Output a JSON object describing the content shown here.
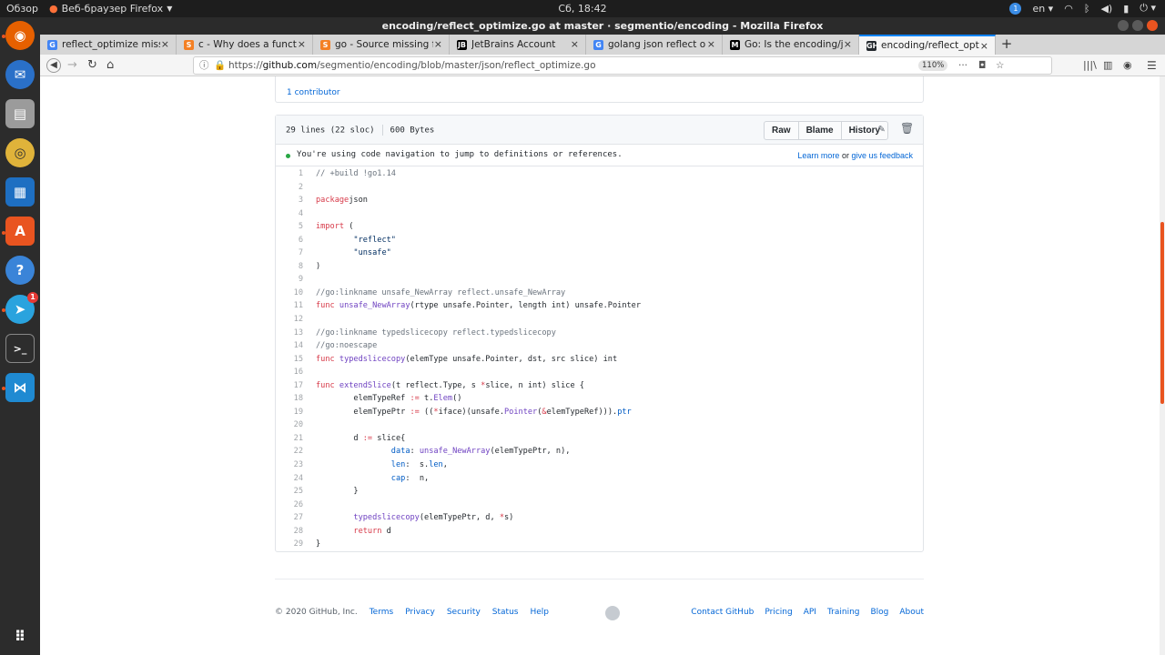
{
  "topbar": {
    "overview": "Обзор",
    "app_name": "Веб-браузер Firefox",
    "clock": "Сб, 18:42",
    "notif_count": "1",
    "lang": "en"
  },
  "window": {
    "title": "encoding/reflect_optimize.go at master · segmentio/encoding - Mozilla Firefox"
  },
  "dock": {
    "telegram_count": "1"
  },
  "tabs": [
    {
      "title": "reflect_optimize missing",
      "fav": "G",
      "color": "#4285f4"
    },
    {
      "title": "c - Why does a function in",
      "fav": "S",
      "color": "#f48024"
    },
    {
      "title": "go - Source missing function",
      "fav": "S",
      "color": "#f48024"
    },
    {
      "title": "JetBrains Account",
      "fav": "JB",
      "color": "#000000"
    },
    {
      "title": "golang json reflect optimize",
      "fav": "G",
      "color": "#4285f4"
    },
    {
      "title": "Go: Is the encoding/json",
      "fav": "M",
      "color": "#000000"
    },
    {
      "title": "encoding/reflect_optimize.go",
      "fav": "GH",
      "color": "#24292e"
    }
  ],
  "nav": {
    "url_prefix": "https://",
    "url_host": "github.com",
    "url_path": "/segmentio/encoding/blob/master/json/reflect_optimize.go",
    "zoom": "110%"
  },
  "contributors": "1 contributor",
  "file": {
    "lines": "29 lines (22 sloc)",
    "size": "600 Bytes",
    "raw": "Raw",
    "blame": "Blame",
    "history": "History"
  },
  "navnote": {
    "message": "You're using code navigation to jump to definitions or references.",
    "learn_more": "Learn more",
    "or": " or ",
    "feedback": "give us feedback"
  },
  "code": [
    [
      [
        "c",
        "// +build !go1.14"
      ]
    ],
    [],
    [
      [
        "k",
        "package"
      ],
      [
        "",
        "json"
      ]
    ],
    [],
    [
      [
        "k",
        "import"
      ],
      [
        "",
        " ("
      ]
    ],
    [
      [
        "",
        "        "
      ],
      [
        "s",
        "\"reflect\""
      ]
    ],
    [
      [
        "",
        "        "
      ],
      [
        "s",
        "\"unsafe\""
      ]
    ],
    [
      [
        "",
        ")"
      ]
    ],
    [],
    [
      [
        "c",
        "//go:linkname unsafe_NewArray reflect.unsafe_NewArray"
      ]
    ],
    [
      [
        "k",
        "func"
      ],
      [
        "",
        " "
      ],
      [
        "f",
        "unsafe_NewArray"
      ],
      [
        "",
        "(rtype unsafe.Pointer, length int) unsafe.Pointer"
      ]
    ],
    [],
    [
      [
        "c",
        "//go:linkname typedslicecopy reflect.typedslicecopy"
      ]
    ],
    [
      [
        "c",
        "//go:noescape"
      ]
    ],
    [
      [
        "k",
        "func"
      ],
      [
        "",
        " "
      ],
      [
        "f",
        "typedslicecopy"
      ],
      [
        "",
        "(elemType unsafe.Pointer, dst, src slice) int"
      ]
    ],
    [],
    [
      [
        "k",
        "func"
      ],
      [
        "",
        " "
      ],
      [
        "f",
        "extendSlice"
      ],
      [
        "",
        "(t reflect.Type, s "
      ],
      [
        "k",
        "*"
      ],
      [
        "",
        "slice, n int) slice {"
      ]
    ],
    [
      [
        "",
        "        elemTypeRef "
      ],
      [
        "k",
        ":="
      ],
      [
        "",
        " t."
      ],
      [
        "f",
        "Elem"
      ],
      [
        "",
        "()"
      ]
    ],
    [
      [
        "",
        "        elemTypePtr "
      ],
      [
        "k",
        ":="
      ],
      [
        "",
        " (("
      ],
      [
        "k",
        "*"
      ],
      [
        "",
        "iface)(unsafe."
      ],
      [
        "f",
        "Pointer"
      ],
      [
        "",
        "("
      ],
      [
        "k",
        "&"
      ],
      [
        "",
        "elemTypeRef)))."
      ],
      [
        "p",
        "ptr"
      ]
    ],
    [],
    [
      [
        "",
        "        d "
      ],
      [
        "k",
        ":="
      ],
      [
        "",
        " slice{"
      ]
    ],
    [
      [
        "",
        "                "
      ],
      [
        "p",
        "data"
      ],
      [
        ":",
        ": "
      ],
      [
        "f",
        "unsafe_NewArray"
      ],
      [
        "",
        "(elemTypePtr, n),"
      ]
    ],
    [
      [
        "",
        "                "
      ],
      [
        "p",
        "len"
      ],
      [
        "",
        ":  s."
      ],
      [
        "p",
        "len"
      ],
      [
        "",
        ","
      ]
    ],
    [
      [
        "",
        "                "
      ],
      [
        "p",
        "cap"
      ],
      [
        "",
        ":  n,"
      ]
    ],
    [
      [
        "",
        "        }"
      ]
    ],
    [],
    [
      [
        "",
        "        "
      ],
      [
        "f",
        "typedslicecopy"
      ],
      [
        "",
        "(elemTypePtr, d, "
      ],
      [
        "k",
        "*"
      ],
      [
        "",
        "s)"
      ]
    ],
    [
      [
        "",
        "        "
      ],
      [
        "k",
        "return"
      ],
      [
        "",
        " d"
      ]
    ],
    [
      [
        "",
        "}"
      ]
    ]
  ],
  "footer": {
    "copyright": "© 2020 GitHub, Inc.",
    "left_links": [
      "Terms",
      "Privacy",
      "Security",
      "Status",
      "Help"
    ],
    "right_links": [
      "Contact GitHub",
      "Pricing",
      "API",
      "Training",
      "Blog",
      "About"
    ]
  }
}
